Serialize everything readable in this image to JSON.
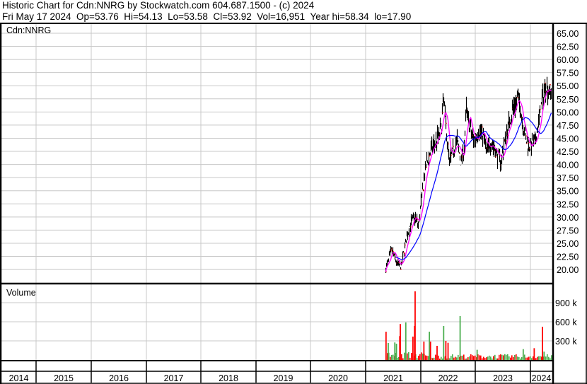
{
  "header": {
    "title": "Historic Chart for Cdn:NNRG by Stockwatch.com 604.687.1500 - (c) 2024",
    "info": "Fri May 17 2024  Op=53.76  Hi=54.13  Lo=53.58  Cl=53.92  Vol=16,951  Year hi=58.34  lo=17.90"
  },
  "colors": {
    "bars": "#000000",
    "close_tick": "#ff0000",
    "ma_short": "#ff00ff",
    "ma_long": "#0000ff",
    "vol_up": "#4caf50",
    "vol_down": "#ff0000",
    "grid": "#c8c8c8"
  },
  "chart_data": [
    {
      "type": "line",
      "title": "Cdn:NNRG",
      "ylabel": "",
      "ylim": [
        17.5,
        66
      ],
      "yticks": [
        "20.00",
        "22.50",
        "25.00",
        "27.50",
        "30.00",
        "32.50",
        "35.00",
        "37.50",
        "40.00",
        "42.50",
        "45.00",
        "47.50",
        "50.00",
        "52.50",
        "55.00",
        "57.50",
        "60.00",
        "62.50",
        "65.00"
      ],
      "xlim": [
        2013.9,
        2024.42
      ],
      "xticks": [
        "2014",
        "2015",
        "2016",
        "2017",
        "2018",
        "2019",
        "2020",
        "2021",
        "2022",
        "2023",
        "2024"
      ],
      "series": [
        {
          "name": "price",
          "t": [
            2021.36,
            2021.47,
            2021.57,
            2021.64,
            2021.72,
            2021.81,
            2021.89,
            2021.96,
            2022.02,
            2022.09,
            2022.17,
            2022.28,
            2022.37,
            2022.42,
            2022.45,
            2022.52,
            2022.58,
            2022.66,
            2022.73,
            2022.79,
            2022.83,
            2022.9,
            2022.96,
            2023.05,
            2023.13,
            2023.2,
            2023.28,
            2023.37,
            2023.46,
            2023.52,
            2023.61,
            2023.69,
            2023.78,
            2023.84,
            2023.93,
            2023.99,
            2024.08,
            2024.15,
            2024.23,
            2024.27,
            2024.34,
            2024.38
          ],
          "close": [
            20.1,
            23.7,
            21.0,
            20.5,
            25.0,
            28.7,
            30.0,
            28.3,
            34.0,
            39.5,
            42.3,
            44.5,
            46.8,
            52.7,
            48.0,
            40.5,
            42.3,
            44.5,
            40.5,
            43.6,
            50.4,
            46.8,
            44.5,
            46.3,
            45.9,
            42.3,
            44.5,
            42.3,
            40.5,
            44.0,
            48.2,
            50.9,
            52.7,
            49.0,
            44.0,
            43.6,
            44.0,
            48.2,
            53.1,
            55.4,
            54.0,
            53.92
          ]
        },
        {
          "name": "moving-average-short"
        },
        {
          "name": "moving-average-long"
        }
      ],
      "year_hi": 58.34,
      "year_lo": 17.9
    },
    {
      "type": "bar",
      "title": "Volume",
      "yticks": [
        "300 k",
        "600 k",
        "900 k"
      ],
      "ylim": [
        0,
        1100000
      ],
      "typical_volume": [
        20000,
        110000
      ],
      "spikes": [
        {
          "t": 2021.36,
          "v": 444000,
          "dir": "down"
        },
        {
          "t": 2021.4,
          "v": 267000,
          "dir": "up"
        },
        {
          "t": 2021.52,
          "v": 275000,
          "dir": "up"
        },
        {
          "t": 2021.55,
          "v": 255000,
          "dir": "up"
        },
        {
          "t": 2021.61,
          "v": 375000,
          "dir": "down"
        },
        {
          "t": 2021.62,
          "v": 565000,
          "dir": "down"
        },
        {
          "t": 2021.72,
          "v": 590000,
          "dir": "up"
        },
        {
          "t": 2021.85,
          "v": 367000,
          "dir": "down"
        },
        {
          "t": 2021.88,
          "v": 533000,
          "dir": "down"
        },
        {
          "t": 2021.89,
          "v": 1078000,
          "dir": "down"
        },
        {
          "t": 2022.05,
          "v": 289000,
          "dir": "down"
        },
        {
          "t": 2022.15,
          "v": 444000,
          "dir": "up"
        },
        {
          "t": 2022.17,
          "v": 289000,
          "dir": "down"
        },
        {
          "t": 2022.29,
          "v": 222000,
          "dir": "down"
        },
        {
          "t": 2022.41,
          "v": 533000,
          "dir": "up"
        },
        {
          "t": 2022.45,
          "v": 300000,
          "dir": "down"
        },
        {
          "t": 2022.49,
          "v": 270000,
          "dir": "down"
        },
        {
          "t": 2022.71,
          "v": 690000,
          "dir": "up"
        },
        {
          "t": 2023.02,
          "v": 160000,
          "dir": "up"
        },
        {
          "t": 2023.86,
          "v": 170000,
          "dir": "up"
        },
        {
          "t": 2024.06,
          "v": 185000,
          "dir": "down"
        },
        {
          "t": 2024.21,
          "v": 522000,
          "dir": "down"
        },
        {
          "t": 2024.24,
          "v": 130000,
          "dir": "up"
        }
      ]
    }
  ]
}
